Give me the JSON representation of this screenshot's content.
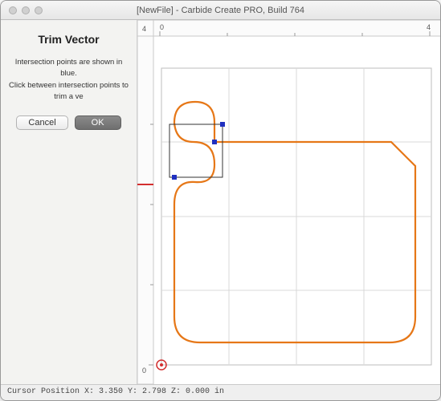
{
  "window": {
    "title": "[NewFile] - Carbide Create PRO, Build 764"
  },
  "panel": {
    "heading": "Trim Vector",
    "instruction_line1": "Intersection points are shown in blue.",
    "instruction_line2": "Click between intersection points to trim a ve",
    "cancel_label": "Cancel",
    "ok_label": "OK"
  },
  "ruler": {
    "top_start": "0",
    "top_end": "4",
    "left_start": "0",
    "left_end": "4"
  },
  "status": {
    "text": "Cursor Position X: 3.350 Y: 2.798 Z: 0.000 in"
  },
  "canvas": {
    "origin_marker_color": "#d32f2f",
    "shape_stroke": "#e67717",
    "selection_stroke": "#333333",
    "intersection_fill": "#2030c0",
    "grid_stroke": "#d9d9d9"
  }
}
